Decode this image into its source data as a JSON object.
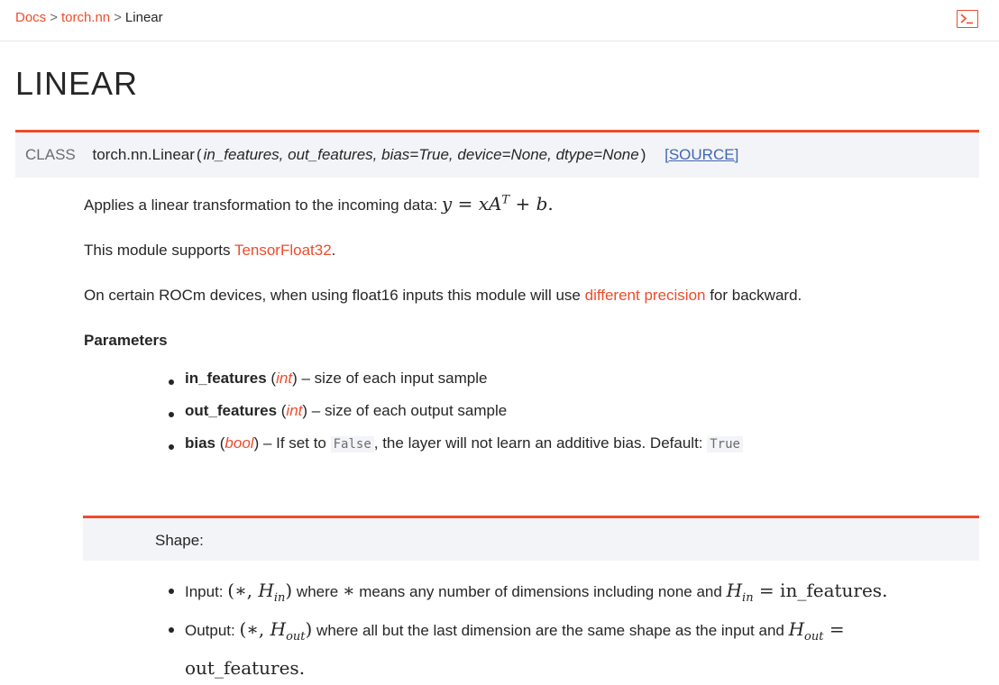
{
  "breadcrumb": {
    "items": [
      "Docs",
      "torch.nn",
      "Linear"
    ],
    "separator": ">"
  },
  "toolbar": {
    "terminal_icon": "terminal-icon"
  },
  "page": {
    "title": "LINEAR"
  },
  "signature": {
    "keyword": "CLASS",
    "name": "torch.nn.Linear",
    "open_paren": "(",
    "params": [
      "in_features,",
      "out_features,",
      "bias=True,",
      "device=None,",
      "dtype=None"
    ],
    "close_paren": ")",
    "source_link": "[SOURCE]"
  },
  "description": {
    "line1_text": "Applies a linear transformation to the incoming data: ",
    "line1_math": {
      "y": "y",
      "eq": "=",
      "x": "x",
      "A": "A",
      "T": "T",
      "plus": "+",
      "b": "b",
      "dot": "."
    },
    "line2_prefix": "This module supports ",
    "line2_link": "TensorFloat32",
    "line2_suffix": ".",
    "line3_prefix": "On certain ROCm devices, when using float16 inputs this module will use ",
    "line3_link": "different precision",
    "line3_suffix": " for backward."
  },
  "parameters": {
    "heading": "Parameters",
    "items": [
      {
        "name": "in_features",
        "type": "int",
        "desc": " – size of each input sample"
      },
      {
        "name": "out_features",
        "type": "int",
        "desc": " – size of each output sample"
      },
      {
        "name": "bias",
        "type": "bool",
        "desc_prefix": " – If set to ",
        "code1": "False",
        "desc_mid": ", the layer will not learn an additive bias. Default: ",
        "code2": "True"
      }
    ]
  },
  "shape": {
    "heading": "Shape:",
    "input": {
      "label": "Input: ",
      "math_open": "(∗, ",
      "math_H": "H",
      "math_in": "in",
      "math_close": ")",
      "text_where": " where ",
      "star": "∗",
      "text_rest": " means any number of dimensions including none and ",
      "eq": "=",
      "rhs": "in_features",
      "dot": "."
    },
    "output": {
      "label": "Output: ",
      "math_open": "(∗, ",
      "math_H": "H",
      "math_out": "out",
      "math_close": ")",
      "text_rest": " where all but the last dimension are the same shape as the input and ",
      "eq": "=",
      "rhs": "out_features",
      "dot": "."
    }
  }
}
